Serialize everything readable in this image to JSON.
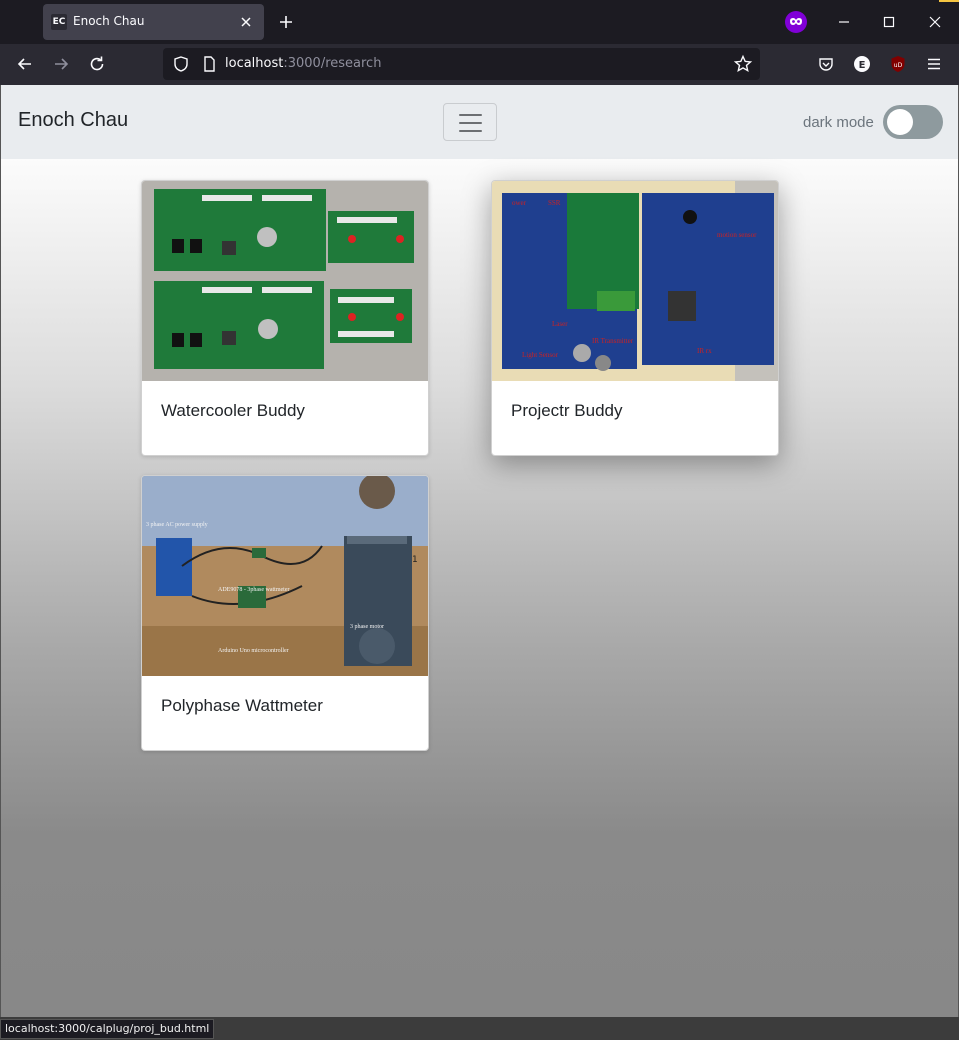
{
  "browser": {
    "tab": {
      "favicon_text": "EC",
      "title": "Enoch Chau"
    },
    "url": {
      "host": "localhost",
      "rest": ":3000/research"
    },
    "status_text": "localhost:3000/calplug/proj_bud.html"
  },
  "site": {
    "brand": "Enoch Chau",
    "dark_mode_label": "dark mode",
    "dark_mode_on": false
  },
  "cards": [
    {
      "title": "Watercooler Buddy",
      "image": "green-pcb-boards-photo"
    },
    {
      "title": "Projectr Buddy",
      "image": "blue-pcb-boards-photo"
    },
    {
      "title": "Polyphase Wattmeter",
      "image": "wattmeter-bench-photo"
    }
  ],
  "photo_labels": {
    "projectr": [
      "ower",
      "SSR",
      "Laser",
      "IR Transmitter",
      "Light Sensor",
      "motion sensor",
      "IR rx"
    ],
    "wattmeter": [
      "3 phase AC power supply",
      "ADE9078 - 3phase wattmeter",
      "3 phase motor",
      "Arduino Uno microcontroller",
      "1"
    ]
  },
  "colors": {
    "accent": "#8000d7",
    "navbar_bg": "#e9ecef",
    "toggle_off": "#8e9a9e"
  }
}
